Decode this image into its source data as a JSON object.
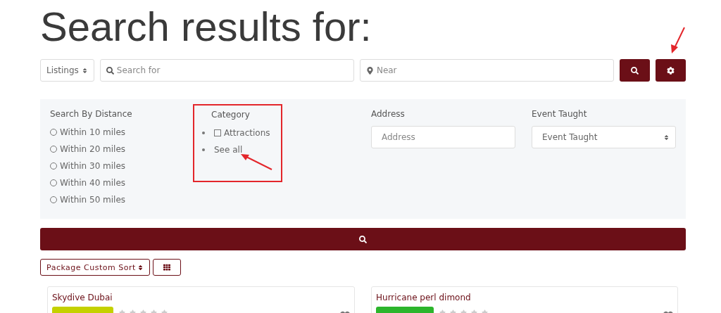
{
  "title": "Search results for:",
  "search_bar": {
    "type_select": "Listings",
    "search_placeholder": "Search for",
    "near_placeholder": "Near"
  },
  "filters": {
    "distance": {
      "label": "Search By Distance",
      "options": [
        {
          "label": "Within 10 miles",
          "selected": false
        },
        {
          "label": "Within 20 miles",
          "selected": false
        },
        {
          "label": "Within 30 miles",
          "selected": false
        },
        {
          "label": "Within 40 miles",
          "selected": false
        },
        {
          "label": "Within 50 miles",
          "selected": false
        }
      ]
    },
    "category": {
      "label": "Category",
      "items": [
        {
          "kind": "checkbox",
          "label": "Attractions",
          "checked": false
        },
        {
          "kind": "link",
          "label": "See all"
        }
      ]
    },
    "address": {
      "label": "Address",
      "placeholder": "Address"
    },
    "event_taught": {
      "label": "Event Taught",
      "value": "Event Taught"
    }
  },
  "sort": {
    "value": "Package Custom Sort"
  },
  "listings": [
    {
      "title": "Skydive Dubai",
      "color": "#c4d100",
      "stars": 0
    },
    {
      "title": "Hurricane perl dimond",
      "color": "#2cb52c",
      "stars": 0
    }
  ]
}
